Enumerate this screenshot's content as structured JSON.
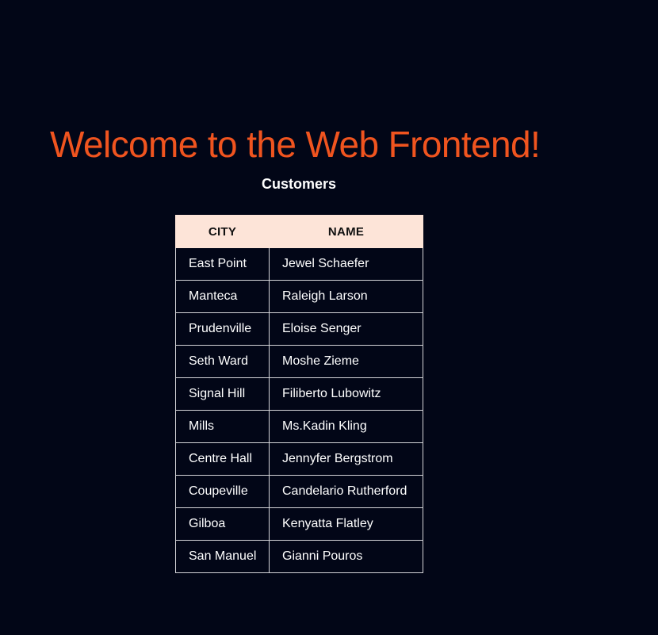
{
  "page": {
    "title": "Welcome to the Web Frontend!",
    "section_title": "Customers"
  },
  "colors": {
    "background": "#020617",
    "title": "#f0541f",
    "header_background": "#fde4d8"
  },
  "table": {
    "headers": {
      "city": "CITY",
      "name": "NAME"
    },
    "rows": [
      {
        "city": "East Point",
        "name": "Jewel Schaefer"
      },
      {
        "city": "Manteca",
        "name": "Raleigh Larson"
      },
      {
        "city": "Prudenville",
        "name": "Eloise Senger"
      },
      {
        "city": "Seth Ward",
        "name": "Moshe Zieme"
      },
      {
        "city": "Signal Hill",
        "name": "Filiberto Lubowitz"
      },
      {
        "city": "Mills",
        "name": "Ms.Kadin Kling"
      },
      {
        "city": "Centre Hall",
        "name": "Jennyfer Bergstrom"
      },
      {
        "city": "Coupeville",
        "name": "Candelario Rutherford"
      },
      {
        "city": "Gilboa",
        "name": "Kenyatta Flatley"
      },
      {
        "city": "San Manuel",
        "name": "Gianni Pouros"
      }
    ]
  }
}
